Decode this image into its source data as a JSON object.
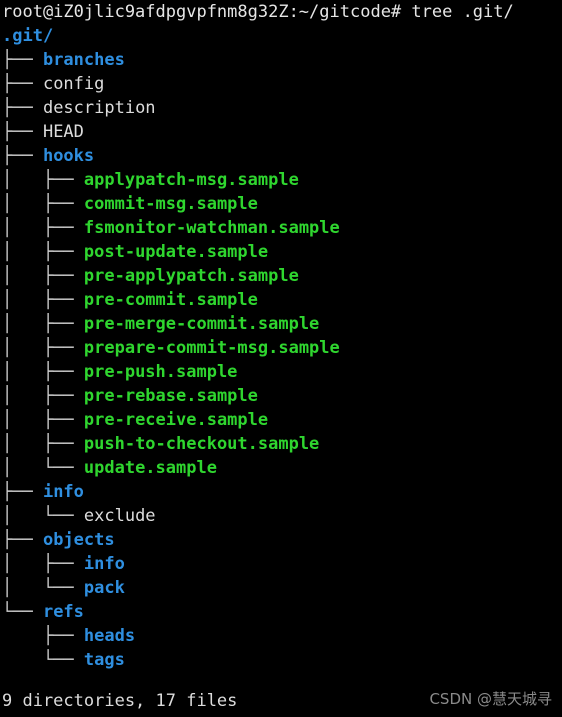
{
  "terminal": {
    "background_color": "#000000",
    "prompt_text": "root@iZ0jlic9afdpgvpfnm8g32Z:~/gitcode# tree .git/",
    "root_label": ".git/",
    "summary_text": "9 directories, 17 files",
    "watermark_text": "CSDN @慧天城寻",
    "colors": {
      "directory": "#2f8fe0",
      "executable": "#2fd62f",
      "file": "#dcdcdc",
      "branch_line": "#cfcfcf"
    }
  },
  "tree": {
    "rows": [
      {
        "prefix": "├── ",
        "name": "branches",
        "kind": "dir"
      },
      {
        "prefix": "├── ",
        "name": "config",
        "kind": "file"
      },
      {
        "prefix": "├── ",
        "name": "description",
        "kind": "file"
      },
      {
        "prefix": "├── ",
        "name": "HEAD",
        "kind": "file"
      },
      {
        "prefix": "├── ",
        "name": "hooks",
        "kind": "dir"
      },
      {
        "prefix": "│   ├── ",
        "name": "applypatch-msg.sample",
        "kind": "exec"
      },
      {
        "prefix": "│   ├── ",
        "name": "commit-msg.sample",
        "kind": "exec"
      },
      {
        "prefix": "│   ├── ",
        "name": "fsmonitor-watchman.sample",
        "kind": "exec"
      },
      {
        "prefix": "│   ├── ",
        "name": "post-update.sample",
        "kind": "exec"
      },
      {
        "prefix": "│   ├── ",
        "name": "pre-applypatch.sample",
        "kind": "exec"
      },
      {
        "prefix": "│   ├── ",
        "name": "pre-commit.sample",
        "kind": "exec"
      },
      {
        "prefix": "│   ├── ",
        "name": "pre-merge-commit.sample",
        "kind": "exec"
      },
      {
        "prefix": "│   ├── ",
        "name": "prepare-commit-msg.sample",
        "kind": "exec"
      },
      {
        "prefix": "│   ├── ",
        "name": "pre-push.sample",
        "kind": "exec"
      },
      {
        "prefix": "│   ├── ",
        "name": "pre-rebase.sample",
        "kind": "exec"
      },
      {
        "prefix": "│   ├── ",
        "name": "pre-receive.sample",
        "kind": "exec"
      },
      {
        "prefix": "│   ├── ",
        "name": "push-to-checkout.sample",
        "kind": "exec"
      },
      {
        "prefix": "│   └── ",
        "name": "update.sample",
        "kind": "exec"
      },
      {
        "prefix": "├── ",
        "name": "info",
        "kind": "dir"
      },
      {
        "prefix": "│   └── ",
        "name": "exclude",
        "kind": "file"
      },
      {
        "prefix": "├── ",
        "name": "objects",
        "kind": "dir"
      },
      {
        "prefix": "│   ├── ",
        "name": "info",
        "kind": "dir"
      },
      {
        "prefix": "│   └── ",
        "name": "pack",
        "kind": "dir"
      },
      {
        "prefix": "└── ",
        "name": "refs",
        "kind": "dir"
      },
      {
        "prefix": "    ├── ",
        "name": "heads",
        "kind": "dir"
      },
      {
        "prefix": "    └── ",
        "name": "tags",
        "kind": "dir"
      }
    ]
  }
}
